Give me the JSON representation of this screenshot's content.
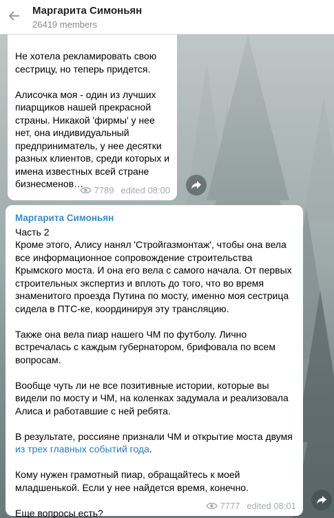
{
  "header": {
    "title": "Маргарита Симоньян",
    "subtitle": "26419 members"
  },
  "message1": {
    "paragraphs": [
      "Не хотела рекламировать свою сестрицу, но теперь придется.",
      "Алисочка моя - один из лучших пиарщиков нашей прекрасной страны. Никакой 'фирмы' у нее нет, она индивидуальный предприниматель, у нее десятки разных клиентов, среди которых и имена известных всей стране бизнесменов…"
    ],
    "views": "7789",
    "edited": "edited 08:00"
  },
  "message2": {
    "sender": "Маргарита Симоньян",
    "part": "Часть 2",
    "p1": "Кроме этого, Алису нанял 'Стройгазмонтаж', чтобы она вела все информационное сопровождение строительства Крымского моста. И она его вела с самого начала. От первых строительных экспертиз и вплоть до того, что во время знаменитого проезда Путина по мосту, именно моя сестрица сидела в ПТС-ке, координируя эту трансляцию.",
    "p2": "Также она вела пиар нашего ЧМ по футболу. Лично встречалась с каждым губернатором, брифовала по всем вопросам.",
    "p3": "Вообще чуть ли не все позитивные истории, которые вы видели по мосту и ЧМ, на коленках задумала и реализовала Алиса и работавшие с ней ребята.",
    "p4_before": "В результате, россияне признали ЧМ и открытие моста двумя ",
    "p4_link1": "из",
    "p4_space": " ",
    "p4_link2": "трех главных событий года",
    "p4_after": ".",
    "p5": "Кому нужен грамотный пиар, обращайтесь к моей младшенькой. Если у нее найдется время, конечно.",
    "p6": "Еще вопросы есть?",
    "views": "7777",
    "edited": "edited 08:01"
  },
  "icons": {
    "back": "arrow-left-icon",
    "views": "eye-icon",
    "share": "share-arrow-icon"
  },
  "colors": {
    "sender": "#3a8cc1",
    "link": "#2f7ab8",
    "meta": "#a5acb3"
  }
}
